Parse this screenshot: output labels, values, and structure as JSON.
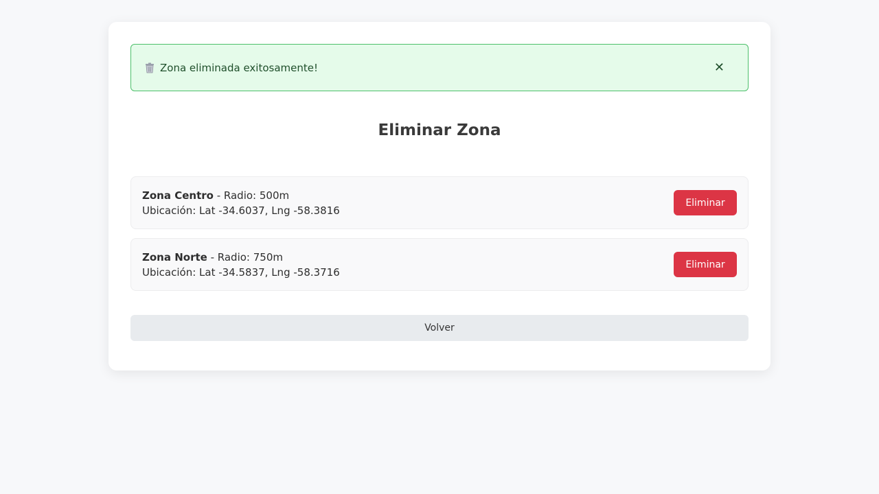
{
  "alert": {
    "icon": "trash-icon",
    "message": "Zona eliminada exitosamente!",
    "close_symbol": "✕"
  },
  "page": {
    "title": "Eliminar Zona"
  },
  "zones": [
    {
      "name": "Zona Centro",
      "radius_text": " - Radio: 500m",
      "location_text": "Ubicación: Lat -34.6037, Lng -58.3816",
      "delete_label": "Eliminar"
    },
    {
      "name": "Zona Norte",
      "radius_text": " - Radio: 750m",
      "location_text": "Ubicación: Lat -34.5837, Lng -58.3716",
      "delete_label": "Eliminar"
    }
  ],
  "footer": {
    "back_label": "Volver"
  },
  "colors": {
    "danger": "#dc3545",
    "success_bg": "#e5fbea",
    "success_border": "#4cbf6a"
  }
}
